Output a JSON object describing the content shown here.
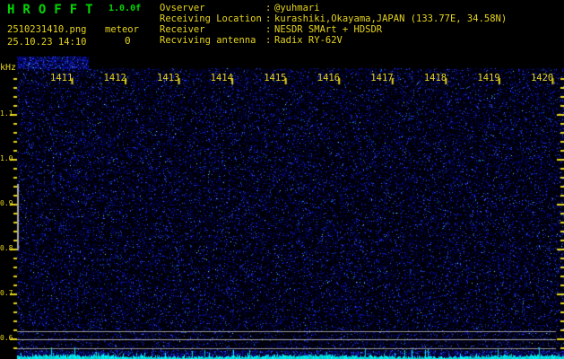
{
  "header": {
    "title": "HROFFT",
    "version": "1.0.0f",
    "filename": "2510231410.png",
    "datetime": "25.10.23 14:10",
    "meteor_label": "meteor",
    "meteor_count": "0",
    "info_rows": [
      {
        "label": "Ovserver",
        "sep": ":",
        "value": "@yuhmari"
      },
      {
        "label": "Receiving Location",
        "sep": ":",
        "value": "kurashiki,Okayama,JAPAN (133.77E, 34.58N)"
      },
      {
        "label": "Receiver",
        "sep": ":",
        "value": "NESDR SMArt + HDSDR"
      },
      {
        "label": "Recviving antenna",
        "sep": ":",
        "value": "Radix RY-62V"
      }
    ]
  },
  "spectrogram": {
    "freq_unit": "kHz",
    "freq_labels": [
      "1.1",
      "1.0",
      "0.9",
      "0.8",
      "0.7",
      "0.6"
    ],
    "time_labels": [
      "1411",
      "1412",
      "1413",
      "1414",
      "1415",
      "1416",
      "1417",
      "1418",
      "1419",
      "1420"
    ]
  },
  "colors": {
    "background": "#000000",
    "title_green": "#00d800",
    "text_yellow": "#e6d41e",
    "axis_gray": "#969696",
    "marker_gray": "#a8a8a8",
    "signal_cyan": "#00dede",
    "noise_dim_blue": "#00004a",
    "noise_mid_blue": "#0a14a0",
    "noise_bright_blue": "#3c64ff"
  }
}
